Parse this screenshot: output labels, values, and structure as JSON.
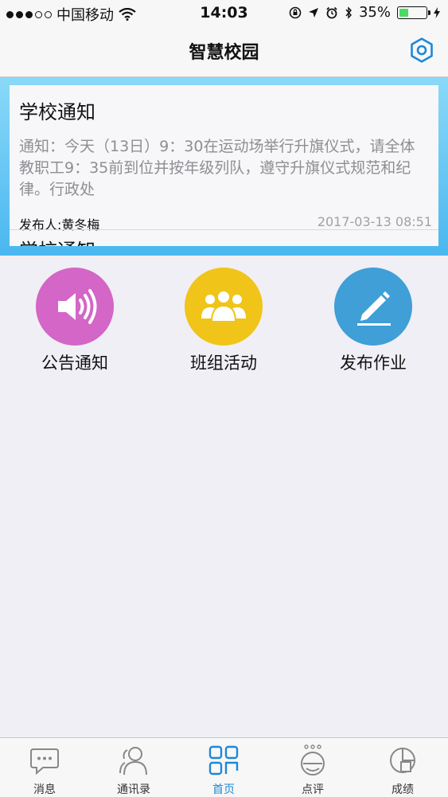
{
  "status_bar": {
    "carrier": "中国移动",
    "time": "14:03",
    "battery_percent": "35%",
    "battery_level": 0.35,
    "signal_bars": 3
  },
  "nav": {
    "title": "智慧校园"
  },
  "notices": [
    {
      "title": "学校通知",
      "body": "通知：今天（13日）9：30在运动场举行升旗仪式，请全体教职工9：35前到位并按年级列队，遵守升旗仪式规范和纪律。行政处",
      "author": "发布人:黄冬梅",
      "date": "2017-03-13  08:51"
    },
    {
      "title": "学校通知"
    }
  ],
  "features": [
    {
      "label": "公告通知",
      "icon": "speaker-icon",
      "color": "#d366c6"
    },
    {
      "label": "班组活动",
      "icon": "group-icon",
      "color": "#f0c419"
    },
    {
      "label": "发布作业",
      "icon": "pencil-icon",
      "color": "#3f9fd6"
    }
  ],
  "tabs": [
    {
      "label": "消息",
      "icon": "chat-icon"
    },
    {
      "label": "通讯录",
      "icon": "contacts-icon"
    },
    {
      "label": "首页",
      "icon": "home-grid-icon",
      "active": true
    },
    {
      "label": "点评",
      "icon": "review-face-icon"
    },
    {
      "label": "成绩",
      "icon": "score-chart-icon"
    }
  ],
  "colors": {
    "accent": "#1e88d6",
    "banner_top": "#8ad9f8",
    "banner_bottom": "#4ab7f0",
    "battery_green": "#4cd964"
  }
}
